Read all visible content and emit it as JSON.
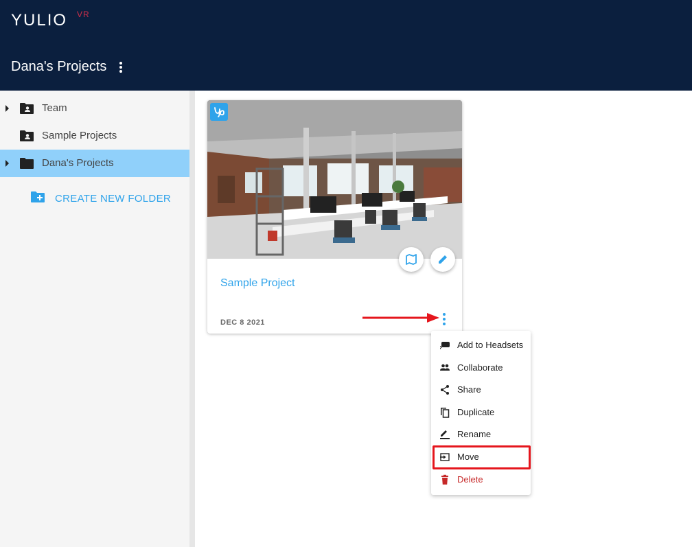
{
  "app": {
    "logo_text": "YULIO",
    "logo_superscript": "VR",
    "page_title": "Dana's Projects"
  },
  "sidebar": {
    "folders": [
      {
        "label": "Team",
        "icon": "shared-folder-icon",
        "expandable": true,
        "selected": false
      },
      {
        "label": "Sample Projects",
        "icon": "shared-folder-icon",
        "expandable": false,
        "selected": false
      },
      {
        "label": "Dana's Projects",
        "icon": "folder-icon",
        "expandable": true,
        "selected": true
      }
    ],
    "create_folder_label": "CREATE NEW FOLDER"
  },
  "project_card": {
    "name": "Sample Project",
    "date": "DEC 8 2021",
    "badge_icon": "yulio-logo-icon",
    "actions": [
      "floorplan-icon",
      "edit-pencil-icon"
    ]
  },
  "context_menu": {
    "items": [
      {
        "label": "Add to Headsets",
        "icon": "headset-icon"
      },
      {
        "label": "Collaborate",
        "icon": "people-icon"
      },
      {
        "label": "Share",
        "icon": "share-icon"
      },
      {
        "label": "Duplicate",
        "icon": "duplicate-icon"
      },
      {
        "label": "Rename",
        "icon": "rename-icon"
      },
      {
        "label": "Move",
        "icon": "move-icon",
        "highlighted": true
      },
      {
        "label": "Delete",
        "icon": "delete-icon",
        "danger": true
      }
    ]
  },
  "colors": {
    "header_bg": "#0b1f3e",
    "accent": "#2fa3ea",
    "selected_folder_bg": "#90d0fa",
    "danger": "#c62828",
    "annotation_red": "#e5161d"
  }
}
